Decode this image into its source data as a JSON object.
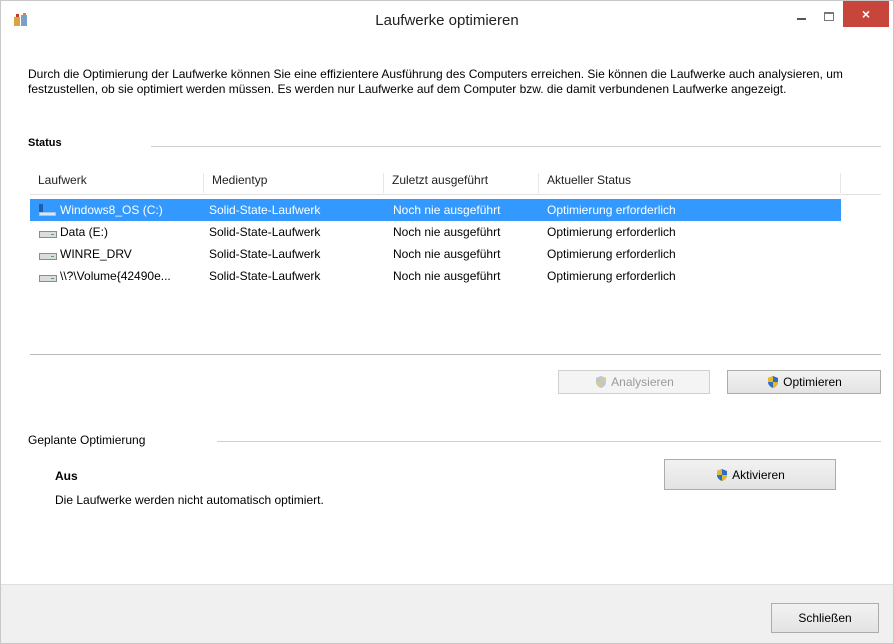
{
  "window": {
    "title": "Laufwerke optimieren",
    "close_glyph": "×"
  },
  "description": "Durch die Optimierung der Laufwerke können Sie eine effizientere Ausführung des Computers erreichen. Sie können die Laufwerke auch analysieren, um festzustellen, ob sie optimiert werden müssen. Es werden nur Laufwerke auf dem Computer bzw. die damit verbundenen Laufwerke angezeigt.",
  "status": {
    "label": "Status",
    "columns": [
      "Laufwerk",
      "Medientyp",
      "Zuletzt ausgeführt",
      "Aktueller Status"
    ],
    "rows": [
      {
        "drive": "Windows8_OS (C:)",
        "media": "Solid-State-Laufwerk",
        "last": "Noch nie ausgeführt",
        "status": "Optimierung erforderlich",
        "icon": "windows-drive-icon"
      },
      {
        "drive": "Data (E:)",
        "media": "Solid-State-Laufwerk",
        "last": "Noch nie ausgeführt",
        "status": "Optimierung erforderlich",
        "icon": "drive-icon"
      },
      {
        "drive": "WINRE_DRV",
        "media": "Solid-State-Laufwerk",
        "last": "Noch nie ausgeführt",
        "status": "Optimierung erforderlich",
        "icon": "drive-icon"
      },
      {
        "drive": "\\\\?\\Volume{42490e...",
        "media": "Solid-State-Laufwerk",
        "last": "Noch nie ausgeführt",
        "status": "Optimierung erforderlich",
        "icon": "drive-icon"
      }
    ]
  },
  "buttons": {
    "analyze": "Analysieren",
    "optimize": "Optimieren",
    "activate": "Aktivieren",
    "close": "Schließen"
  },
  "schedule": {
    "label": "Geplante Optimierung",
    "state": "Aus",
    "description": "Die Laufwerke werden nicht automatisch optimiert."
  },
  "colors": {
    "selection": "#3399ff",
    "close_button": "#c7453a"
  }
}
